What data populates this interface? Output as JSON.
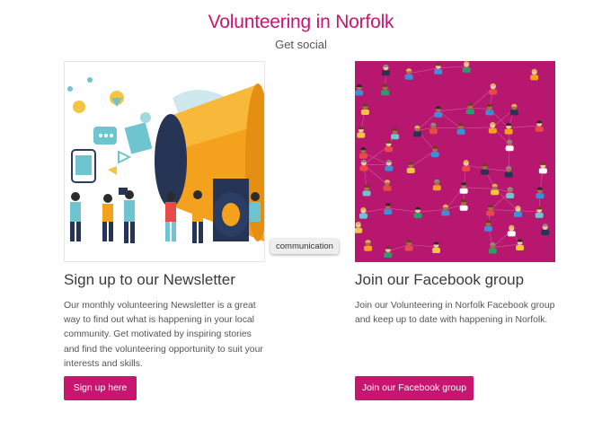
{
  "header": {
    "title": "Volunteering in Norfolk",
    "subtitle": "Get social"
  },
  "newsletter": {
    "title": "Sign up to our Newsletter",
    "description": "Our monthly volunteering Newsletter is a great way to find out what is happening in your local community. Get motivated by inspiring stories and find the volunteering opportunity to suit your interests and skills.",
    "button_label": "Sign up here",
    "image_icon": "megaphone-illustration"
  },
  "tooltip": {
    "text": "communication"
  },
  "facebook": {
    "title": "Join our Facebook group",
    "description": "Join our Volunteering in Norfolk Facebook group and keep up to date with happening in Norfolk.",
    "button_label": "Join our Facebook group",
    "image_icon": "network-people-illustration"
  },
  "colors": {
    "brand": "#c8156f",
    "network_bg": "#b8176f"
  }
}
